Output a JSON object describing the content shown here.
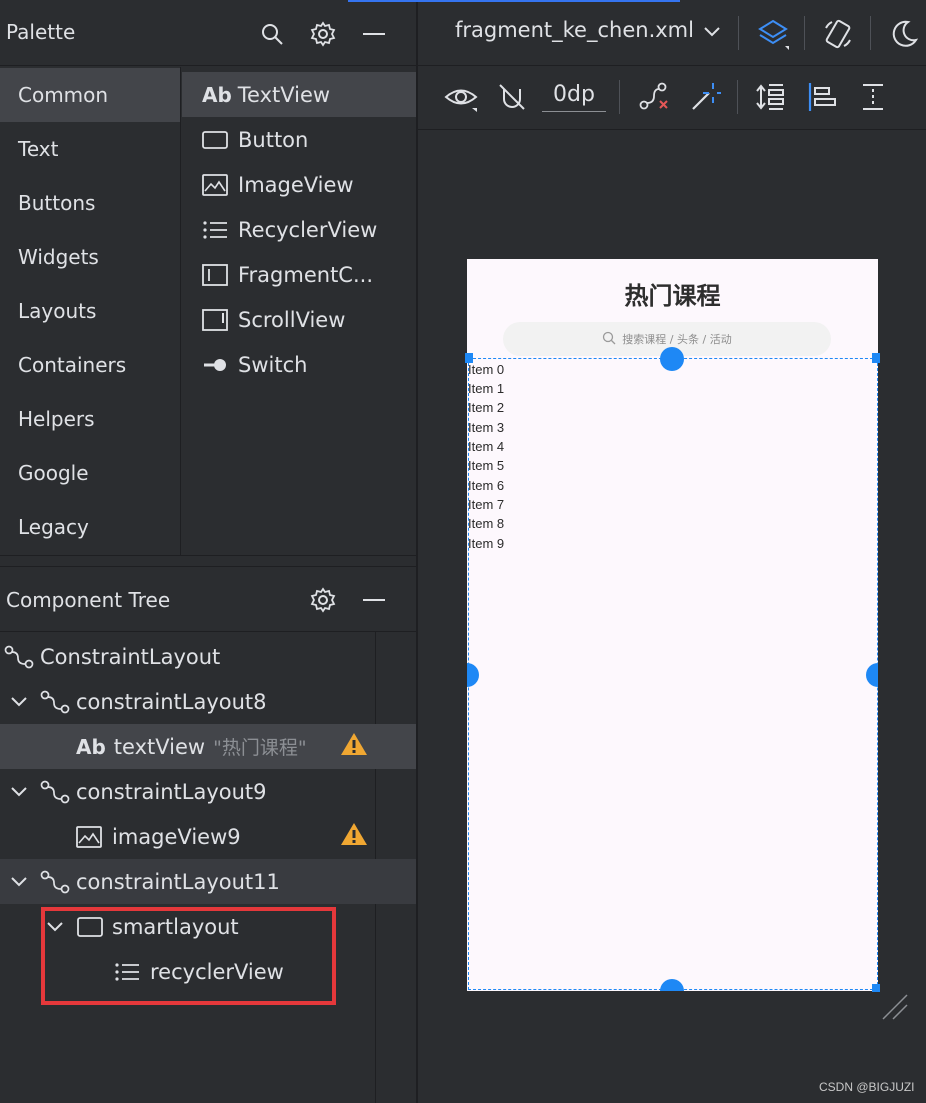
{
  "palette": {
    "title": "Palette",
    "categories": [
      "Common",
      "Text",
      "Buttons",
      "Widgets",
      "Layouts",
      "Containers",
      "Helpers",
      "Google",
      "Legacy"
    ],
    "selected_category": "Common",
    "widgets": [
      {
        "label": "TextView",
        "prefix": "Ab",
        "icon": "textview-icon"
      },
      {
        "label": "Button",
        "icon": "button-icon"
      },
      {
        "label": "ImageView",
        "icon": "image-icon"
      },
      {
        "label": "RecyclerView",
        "icon": "list-icon"
      },
      {
        "label": "FragmentC...",
        "icon": "fragment-icon"
      },
      {
        "label": "ScrollView",
        "icon": "scrollview-icon"
      },
      {
        "label": "Switch",
        "icon": "switch-icon"
      }
    ]
  },
  "component_tree": {
    "title": "Component Tree",
    "nodes": [
      {
        "label": "ConstraintLayout",
        "icon": "constraint-icon",
        "depth": 0
      },
      {
        "label": "constraintLayout8",
        "icon": "constraint-icon",
        "depth": 1,
        "expanded": true
      },
      {
        "label": "textView",
        "prefix": "Ab",
        "hint": "\"热门课程\"",
        "icon": "textview-icon",
        "depth": 2,
        "warning": true
      },
      {
        "label": "constraintLayout9",
        "icon": "constraint-icon",
        "depth": 1,
        "expanded": true
      },
      {
        "label": "imageView9",
        "icon": "image-icon",
        "depth": 2,
        "warning": true
      },
      {
        "label": "constraintLayout11",
        "icon": "constraint-icon",
        "depth": 1,
        "expanded": true
      },
      {
        "label": "smartlayout",
        "icon": "view-icon",
        "depth": 2,
        "expanded": true
      },
      {
        "label": "recyclerView",
        "icon": "list-icon",
        "depth": 3
      }
    ]
  },
  "editor": {
    "file_tab": "fragment_ke_chen.xml",
    "margin_value": "0dp"
  },
  "preview": {
    "title": "热门课程",
    "search_placeholder": "搜索课程 / 头条 / 活动",
    "items": [
      "Item 0",
      "Item 1",
      "Item 2",
      "Item 3",
      "Item 4",
      "Item 5",
      "Item 6",
      "Item 7",
      "Item 8",
      "Item 9"
    ]
  },
  "watermark": "CSDN @BIGJUZI",
  "colors": {
    "accent": "#1e88f5",
    "warning": "#f0a732",
    "highlight_box": "#e5383b",
    "panel_bg": "#2b2d30",
    "selected_bg": "#43454a"
  }
}
